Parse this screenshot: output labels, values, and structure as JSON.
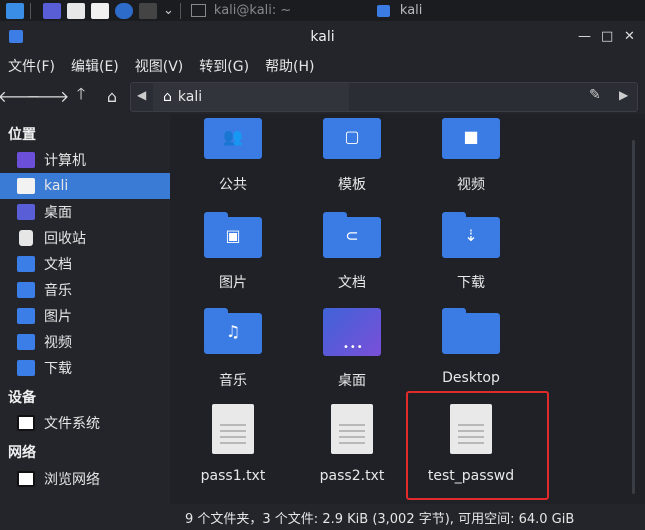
{
  "taskbar": {
    "terminal_title": "kali@kali: ~",
    "folder_title": "kali"
  },
  "window": {
    "title": "kali"
  },
  "menu": [
    "文件(F)",
    "编辑(E)",
    "视图(V)",
    "转到(G)",
    "帮助(H)"
  ],
  "path": {
    "current": "kali"
  },
  "sidebar": {
    "places_header": "位置",
    "places": [
      {
        "label": "计算机",
        "icon": "computer-icon"
      },
      {
        "label": "kali",
        "icon": "home-folder-icon",
        "active": true
      },
      {
        "label": "桌面",
        "icon": "desktop-icon"
      },
      {
        "label": "回收站",
        "icon": "trash-icon"
      },
      {
        "label": "文档",
        "icon": "documents-icon"
      },
      {
        "label": "音乐",
        "icon": "music-icon"
      },
      {
        "label": "图片",
        "icon": "pictures-icon"
      },
      {
        "label": "视频",
        "icon": "videos-icon"
      },
      {
        "label": "下载",
        "icon": "downloads-icon"
      }
    ],
    "devices_header": "设备",
    "devices": [
      {
        "label": "文件系统",
        "icon": "drive-icon"
      }
    ],
    "network_header": "网络",
    "network": [
      {
        "label": "浏览网络",
        "icon": "network-icon"
      }
    ]
  },
  "items": [
    {
      "label": "公共",
      "kind": "folder",
      "glyph": "people-icon"
    },
    {
      "label": "模板",
      "kind": "folder",
      "glyph": "template-icon"
    },
    {
      "label": "视频",
      "kind": "folder",
      "glyph": "video-icon"
    },
    {
      "label": "图片",
      "kind": "folder",
      "glyph": "picture-icon"
    },
    {
      "label": "文档",
      "kind": "folder",
      "glyph": "attachment-icon"
    },
    {
      "label": "下载",
      "kind": "folder",
      "glyph": "download-icon"
    },
    {
      "label": "音乐",
      "kind": "folder",
      "glyph": "music-note-icon"
    },
    {
      "label": "桌面",
      "kind": "desktop",
      "glyph": "desktop-icon"
    },
    {
      "label": "Desktop",
      "kind": "folder",
      "glyph": ""
    },
    {
      "label": "pass1.txt",
      "kind": "file"
    },
    {
      "label": "pass2.txt",
      "kind": "file"
    },
    {
      "label": "test_passwd",
      "kind": "file"
    }
  ],
  "status": "9 个文件夹，3 个文件: 2.9 KiB (3,002 字节), 可用空间: 64.0 GiB",
  "colors": {
    "accent": "#3a7be4",
    "highlight": "#e12a2a"
  }
}
